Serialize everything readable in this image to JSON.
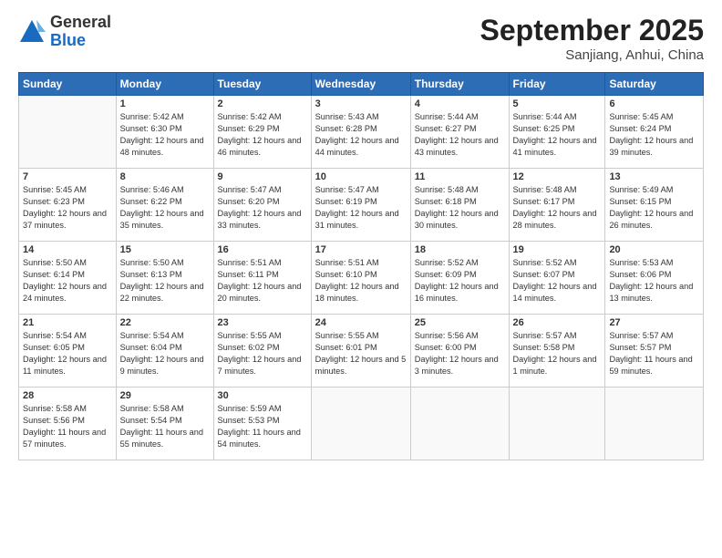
{
  "header": {
    "logo_general": "General",
    "logo_blue": "Blue",
    "month": "September 2025",
    "location": "Sanjiang, Anhui, China"
  },
  "days_of_week": [
    "Sunday",
    "Monday",
    "Tuesday",
    "Wednesday",
    "Thursday",
    "Friday",
    "Saturday"
  ],
  "weeks": [
    [
      {
        "day": "",
        "empty": true
      },
      {
        "day": "1",
        "sunrise": "5:42 AM",
        "sunset": "6:30 PM",
        "daylight": "12 hours and 48 minutes."
      },
      {
        "day": "2",
        "sunrise": "5:42 AM",
        "sunset": "6:29 PM",
        "daylight": "12 hours and 46 minutes."
      },
      {
        "day": "3",
        "sunrise": "5:43 AM",
        "sunset": "6:28 PM",
        "daylight": "12 hours and 44 minutes."
      },
      {
        "day": "4",
        "sunrise": "5:44 AM",
        "sunset": "6:27 PM",
        "daylight": "12 hours and 43 minutes."
      },
      {
        "day": "5",
        "sunrise": "5:44 AM",
        "sunset": "6:25 PM",
        "daylight": "12 hours and 41 minutes."
      },
      {
        "day": "6",
        "sunrise": "5:45 AM",
        "sunset": "6:24 PM",
        "daylight": "12 hours and 39 minutes."
      }
    ],
    [
      {
        "day": "7",
        "sunrise": "5:45 AM",
        "sunset": "6:23 PM",
        "daylight": "12 hours and 37 minutes."
      },
      {
        "day": "8",
        "sunrise": "5:46 AM",
        "sunset": "6:22 PM",
        "daylight": "12 hours and 35 minutes."
      },
      {
        "day": "9",
        "sunrise": "5:47 AM",
        "sunset": "6:20 PM",
        "daylight": "12 hours and 33 minutes."
      },
      {
        "day": "10",
        "sunrise": "5:47 AM",
        "sunset": "6:19 PM",
        "daylight": "12 hours and 31 minutes."
      },
      {
        "day": "11",
        "sunrise": "5:48 AM",
        "sunset": "6:18 PM",
        "daylight": "12 hours and 30 minutes."
      },
      {
        "day": "12",
        "sunrise": "5:48 AM",
        "sunset": "6:17 PM",
        "daylight": "12 hours and 28 minutes."
      },
      {
        "day": "13",
        "sunrise": "5:49 AM",
        "sunset": "6:15 PM",
        "daylight": "12 hours and 26 minutes."
      }
    ],
    [
      {
        "day": "14",
        "sunrise": "5:50 AM",
        "sunset": "6:14 PM",
        "daylight": "12 hours and 24 minutes."
      },
      {
        "day": "15",
        "sunrise": "5:50 AM",
        "sunset": "6:13 PM",
        "daylight": "12 hours and 22 minutes."
      },
      {
        "day": "16",
        "sunrise": "5:51 AM",
        "sunset": "6:11 PM",
        "daylight": "12 hours and 20 minutes."
      },
      {
        "day": "17",
        "sunrise": "5:51 AM",
        "sunset": "6:10 PM",
        "daylight": "12 hours and 18 minutes."
      },
      {
        "day": "18",
        "sunrise": "5:52 AM",
        "sunset": "6:09 PM",
        "daylight": "12 hours and 16 minutes."
      },
      {
        "day": "19",
        "sunrise": "5:52 AM",
        "sunset": "6:07 PM",
        "daylight": "12 hours and 14 minutes."
      },
      {
        "day": "20",
        "sunrise": "5:53 AM",
        "sunset": "6:06 PM",
        "daylight": "12 hours and 13 minutes."
      }
    ],
    [
      {
        "day": "21",
        "sunrise": "5:54 AM",
        "sunset": "6:05 PM",
        "daylight": "12 hours and 11 minutes."
      },
      {
        "day": "22",
        "sunrise": "5:54 AM",
        "sunset": "6:04 PM",
        "daylight": "12 hours and 9 minutes."
      },
      {
        "day": "23",
        "sunrise": "5:55 AM",
        "sunset": "6:02 PM",
        "daylight": "12 hours and 7 minutes."
      },
      {
        "day": "24",
        "sunrise": "5:55 AM",
        "sunset": "6:01 PM",
        "daylight": "12 hours and 5 minutes."
      },
      {
        "day": "25",
        "sunrise": "5:56 AM",
        "sunset": "6:00 PM",
        "daylight": "12 hours and 3 minutes."
      },
      {
        "day": "26",
        "sunrise": "5:57 AM",
        "sunset": "5:58 PM",
        "daylight": "12 hours and 1 minute."
      },
      {
        "day": "27",
        "sunrise": "5:57 AM",
        "sunset": "5:57 PM",
        "daylight": "11 hours and 59 minutes."
      }
    ],
    [
      {
        "day": "28",
        "sunrise": "5:58 AM",
        "sunset": "5:56 PM",
        "daylight": "11 hours and 57 minutes."
      },
      {
        "day": "29",
        "sunrise": "5:58 AM",
        "sunset": "5:54 PM",
        "daylight": "11 hours and 55 minutes."
      },
      {
        "day": "30",
        "sunrise": "5:59 AM",
        "sunset": "5:53 PM",
        "daylight": "11 hours and 54 minutes."
      },
      {
        "day": "",
        "empty": true
      },
      {
        "day": "",
        "empty": true
      },
      {
        "day": "",
        "empty": true
      },
      {
        "day": "",
        "empty": true
      }
    ]
  ]
}
